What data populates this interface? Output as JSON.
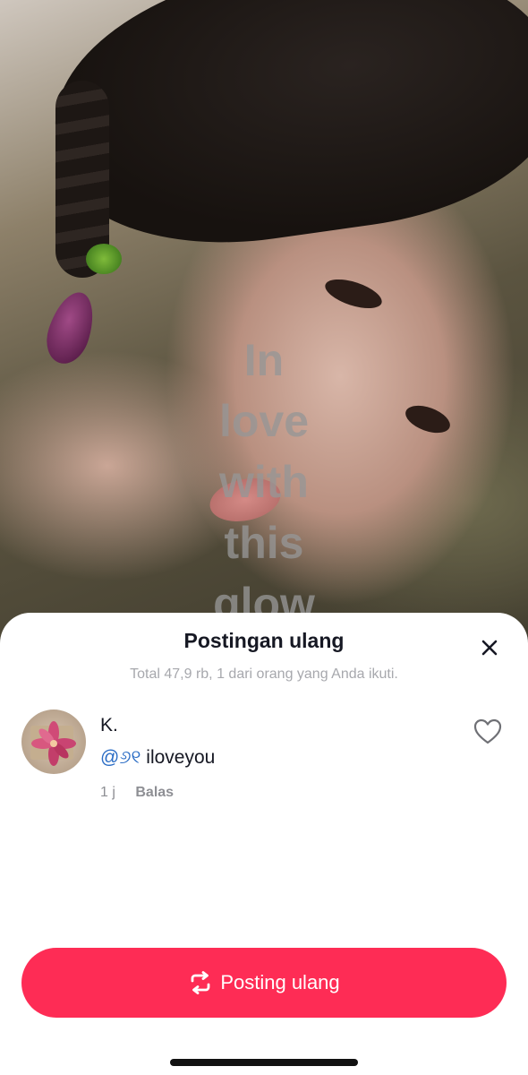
{
  "background_video": {
    "overlay_text": "In\nlove\nwith\nthis\nglow"
  },
  "sheet": {
    "title": "Postingan ulang",
    "subtitle": "Total 47,9 rb, 1 dari orang yang Anda ikuti.",
    "close_icon": "close-icon"
  },
  "repost_item": {
    "username": "K.",
    "mention": "@୬୧",
    "text": " iloveyou",
    "time": "1 j",
    "reply_label": "Balas",
    "like_icon": "heart-outline-icon"
  },
  "footer": {
    "repost_button_label": "Posting ulang",
    "repost_icon": "repost-arrows-icon"
  },
  "colors": {
    "accent": "#fe2c55",
    "mention": "#2b6dc5",
    "text_primary": "#161823",
    "text_secondary": "#a7a8ad"
  }
}
